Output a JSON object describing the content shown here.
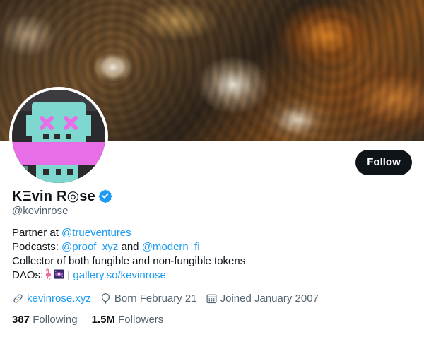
{
  "profile": {
    "display_name": "KΞvin R◎se",
    "handle": "@kevinrose",
    "follow_label": "Follow",
    "bio": {
      "line1_prefix": "Partner at ",
      "line1_link": "@trueventures",
      "line2_prefix": "Podcasts: ",
      "line2_link1": "@proof_xyz",
      "line2_mid": " and ",
      "line2_link2": "@modern_fi",
      "line3": "Collector of both fungible and non-fungible tokens",
      "line4_prefix": "DAOs:",
      "line4_sep": " | ",
      "line4_link": "gallery.so/kevinrose"
    },
    "meta": {
      "website": "kevinrose.xyz",
      "birthday": "Born February 21",
      "joined": "Joined January 2007"
    },
    "stats": {
      "following_count": "387",
      "following_label": "Following",
      "followers_count": "1.5M",
      "followers_label": "Followers"
    }
  },
  "colors": {
    "accent": "#1d9bf0",
    "text": "#0f1419",
    "secondary": "#536471",
    "button_bg": "#0f1419",
    "avatar_pink": "#e86ee8",
    "avatar_teal": "#7fd8d0"
  },
  "icons": {
    "verified": "verified-badge-icon",
    "website": "link-icon",
    "birthday": "balloon-icon",
    "joined": "calendar-icon",
    "emoji1": "flamingo-emoji",
    "emoji2": "galaxy-emoji"
  }
}
